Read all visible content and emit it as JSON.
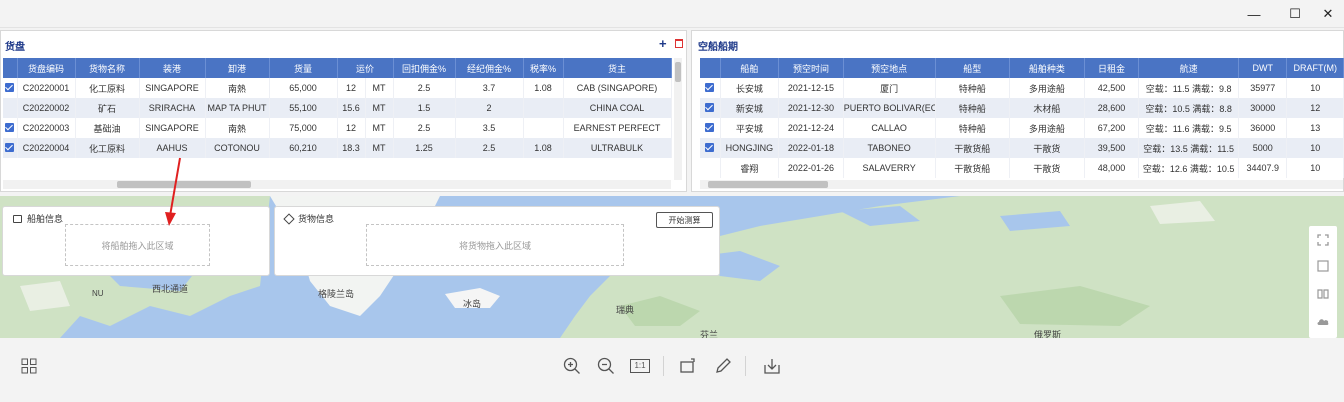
{
  "window": {
    "minimize": "—",
    "maximize": "☐",
    "close": "✕"
  },
  "cargo_panel": {
    "title": "货盘",
    "add_icon": "plus-icon",
    "delete_icon": "trash-icon",
    "columns": [
      "货盘编码",
      "货物名称",
      "装港",
      "卸港",
      "货量",
      "运价",
      "回扣佣金%",
      "经纪佣金%",
      "税率%",
      "货主"
    ],
    "rows": [
      {
        "code": "C20220001",
        "name": "化工原料",
        "load": "SINGAPORE",
        "discharge": "南熱",
        "qty": "65,000",
        "rate": "12",
        "unit": "MT",
        "rebate": "2.5",
        "broker": "3.7",
        "tax": "1.08",
        "owner": "CAB (SINGAPORE)"
      },
      {
        "code": "C20220002",
        "name": "矿石",
        "load": "SRIRACHA",
        "discharge": "MAP TA PHUT",
        "qty": "55,100",
        "rate": "15.6",
        "unit": "MT",
        "rebate": "1.5",
        "broker": "2",
        "tax": "",
        "owner": "CHINA COAL"
      },
      {
        "code": "C20220003",
        "name": "基础油",
        "load": "SINGAPORE",
        "discharge": "南熱",
        "qty": "75,000",
        "rate": "12",
        "unit": "MT",
        "rebate": "2.5",
        "broker": "3.5",
        "tax": "",
        "owner": "EARNEST PERFECT"
      },
      {
        "code": "C20220004",
        "name": "化工原料",
        "load": "AAHUS",
        "discharge": "COTONOU",
        "qty": "60,210",
        "rate": "18.3",
        "unit": "MT",
        "rebate": "1.25",
        "broker": "2.5",
        "tax": "1.08",
        "owner": "ULTRABULK"
      }
    ]
  },
  "ship_panel": {
    "title": "空船船期",
    "columns": [
      "船舶",
      "预空时间",
      "预空地点",
      "船型",
      "船舶种类",
      "日租金",
      "航速",
      "DWT",
      "DRAFT(M)"
    ],
    "rows": [
      {
        "ship": "长安城",
        "date": "2021-12-15",
        "place": "厦门",
        "type": "特种船",
        "kind": "多用途船",
        "hire": "42,500",
        "speed": "空载：11.5  满载：9.8",
        "dwt": "35977",
        "draft": "10"
      },
      {
        "ship": "新安城",
        "date": "2021-12-30",
        "place": "PUERTO BOLIVAR(EC)",
        "type": "特种船",
        "kind": "木材船",
        "hire": "28,600",
        "speed": "空载：10.5  满载：8.8",
        "dwt": "30000",
        "draft": "12"
      },
      {
        "ship": "平安城",
        "date": "2021-12-24",
        "place": "CALLAO",
        "type": "特种船",
        "kind": "多用途船",
        "hire": "67,200",
        "speed": "空载：11.6  满载：9.5",
        "dwt": "36000",
        "draft": "13"
      },
      {
        "ship": "HONGJING",
        "date": "2022-01-18",
        "place": "TABONEO",
        "type": "干散货船",
        "kind": "干散货",
        "hire": "39,500",
        "speed": "空载：13.5  满载：11.5",
        "dwt": "5000",
        "draft": "10"
      },
      {
        "ship": "睿翔",
        "date": "2022-01-26",
        "place": "SALAVERRY",
        "type": "干散货船",
        "kind": "干散货",
        "hire": "48,000",
        "speed": "空载：12.6  满载：10.5",
        "dwt": "34407.9",
        "draft": "10"
      }
    ]
  },
  "ship_info": {
    "title": "船舶信息",
    "icon": "ship-icon",
    "drop_hint": "将船舶拖入此区域"
  },
  "cargo_info": {
    "title": "货物信息",
    "icon": "cube-icon",
    "drop_hint": "将货物拖入此区域",
    "calc_button": "开始测算"
  },
  "map": {
    "labels": [
      "格陵兰岛",
      "冰岛",
      "瑞典",
      "俄罗斯",
      "西北通道",
      "NU",
      "芬兰"
    ],
    "colors": {
      "water": "#a8c6ec",
      "land": "#cfe2c4",
      "ice": "#f5f5f5"
    }
  },
  "map_tools": [
    "fullscreen-icon",
    "box-select-icon",
    "map-book-icon",
    "weather-icon"
  ],
  "bottom_toolbar": {
    "left": "grid-icon",
    "center": [
      "zoom-in-icon",
      "zoom-out-icon",
      "actual-size-icon",
      "rotate-icon",
      "pen-icon",
      "download-icon"
    ],
    "actual_size_label": "1:1"
  }
}
